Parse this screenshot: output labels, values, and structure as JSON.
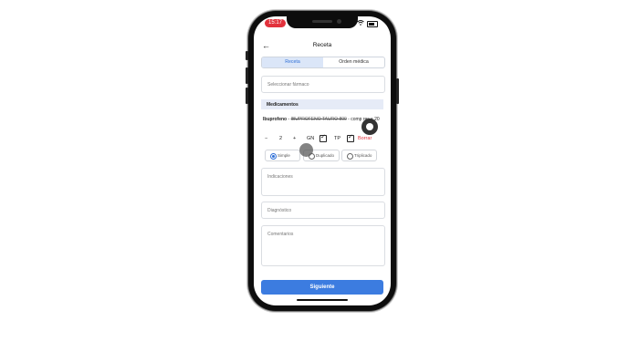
{
  "status_bar": {
    "time": "15:17"
  },
  "header": {
    "back_icon": "arrow-left-icon",
    "title": "Receta"
  },
  "tabs": [
    {
      "label": "Receta",
      "active": true
    },
    {
      "label": "Orden médica",
      "active": false
    }
  ],
  "drug_select": {
    "placeholder": "Seleccionar fármaco"
  },
  "medications": {
    "section_label": "Medicamentos",
    "item": {
      "name": "Ibuprofeno",
      "separator": " - ",
      "brand": "IBUPROFENO TAURO 800",
      "detail": " - comp rec x 20",
      "quantity": "2",
      "gn_label": "GN",
      "tp_label": "TP",
      "delete_label": "Borrar",
      "gn_checked": true,
      "tp_checked": true
    }
  },
  "copies": {
    "options": [
      "Simple",
      "Duplicado",
      "Triplicado"
    ],
    "selected": "Simple"
  },
  "indications": {
    "placeholder": "Indicaciones"
  },
  "diagnosis": {
    "placeholder": "Diagnóstico"
  },
  "comments": {
    "placeholder": "Comentarios"
  },
  "next_button": {
    "label": "Siguiente"
  },
  "colors": {
    "accent": "#3c7ce0",
    "danger": "#e2323c",
    "section_bg": "#e6ebf7"
  }
}
